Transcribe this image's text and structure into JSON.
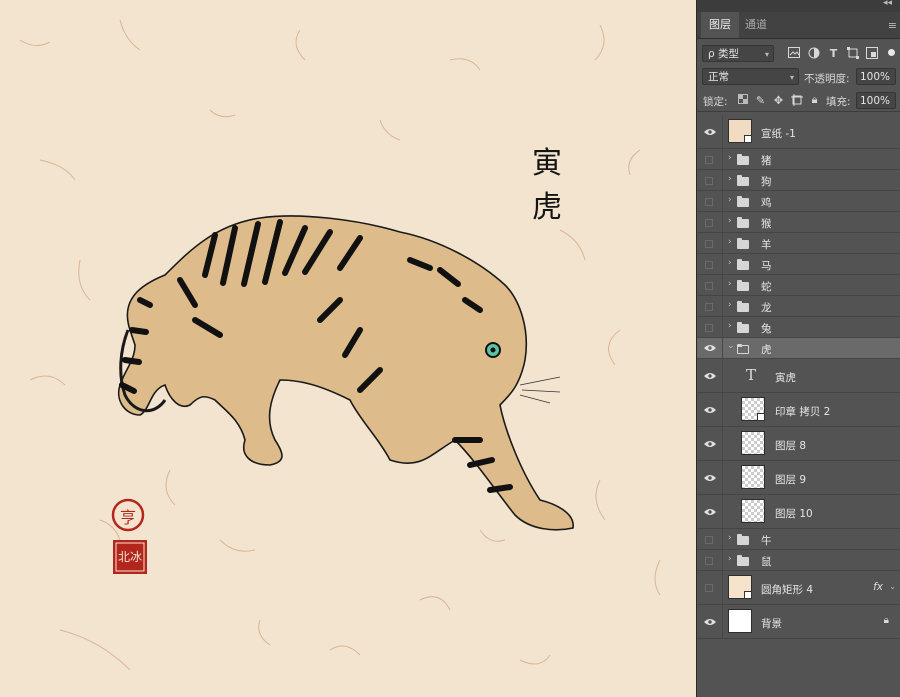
{
  "canvas": {
    "title_chars": [
      "寅",
      "虎"
    ],
    "seal_text": "亨",
    "seal2_text": "北冰"
  },
  "panel": {
    "top_arrows": "◂◂",
    "tabs": [
      {
        "label": "图层",
        "active": true
      },
      {
        "label": "通道",
        "active": false
      }
    ],
    "menu_icon": "≡",
    "filter": {
      "label": "ρ 类型",
      "icons": [
        "image-filter-icon",
        "adjustment-filter-icon",
        "text-filter-icon",
        "shape-filter-icon",
        "smartobject-filter-icon"
      ]
    },
    "blend_mode": "正常",
    "opacity_label": "不透明度:",
    "opacity_value": "100%",
    "lock_label": "锁定:",
    "fill_label": "填充:",
    "fill_value": "100%"
  },
  "layers": [
    {
      "name": "宣纸 -1",
      "kind": "smart",
      "visible": true
    },
    {
      "name": "猪",
      "kind": "group",
      "visible": false
    },
    {
      "name": "狗",
      "kind": "group",
      "visible": false
    },
    {
      "name": "鸡",
      "kind": "group",
      "visible": false
    },
    {
      "name": "猴",
      "kind": "group",
      "visible": false
    },
    {
      "name": "羊",
      "kind": "group",
      "visible": false
    },
    {
      "name": "马",
      "kind": "group",
      "visible": false
    },
    {
      "name": "蛇",
      "kind": "group",
      "visible": false
    },
    {
      "name": "龙",
      "kind": "group",
      "visible": false
    },
    {
      "name": "兔",
      "kind": "group",
      "visible": false
    },
    {
      "name": "虎",
      "kind": "group-open",
      "visible": true,
      "selected": true
    },
    {
      "name": "寅虎",
      "kind": "text",
      "visible": true
    },
    {
      "name": "印章 拷贝 2",
      "kind": "smart-child",
      "visible": true
    },
    {
      "name": "图层 8",
      "kind": "pixel",
      "visible": true
    },
    {
      "name": "图层 9",
      "kind": "pixel",
      "visible": true
    },
    {
      "name": "图层 10",
      "kind": "pixel",
      "visible": true
    },
    {
      "name": "牛",
      "kind": "group",
      "visible": false
    },
    {
      "name": "鼠",
      "kind": "group",
      "visible": false
    },
    {
      "name": "圆角矩形 4",
      "kind": "shape",
      "visible": false,
      "fx": "fx"
    },
    {
      "name": "背景",
      "kind": "background",
      "visible": true,
      "locked": true
    }
  ],
  "colors": {
    "paper": "#f3e4cf",
    "panel": "#535353",
    "selected_row": "#6a6a6a",
    "seal_red": "#b3261e"
  }
}
